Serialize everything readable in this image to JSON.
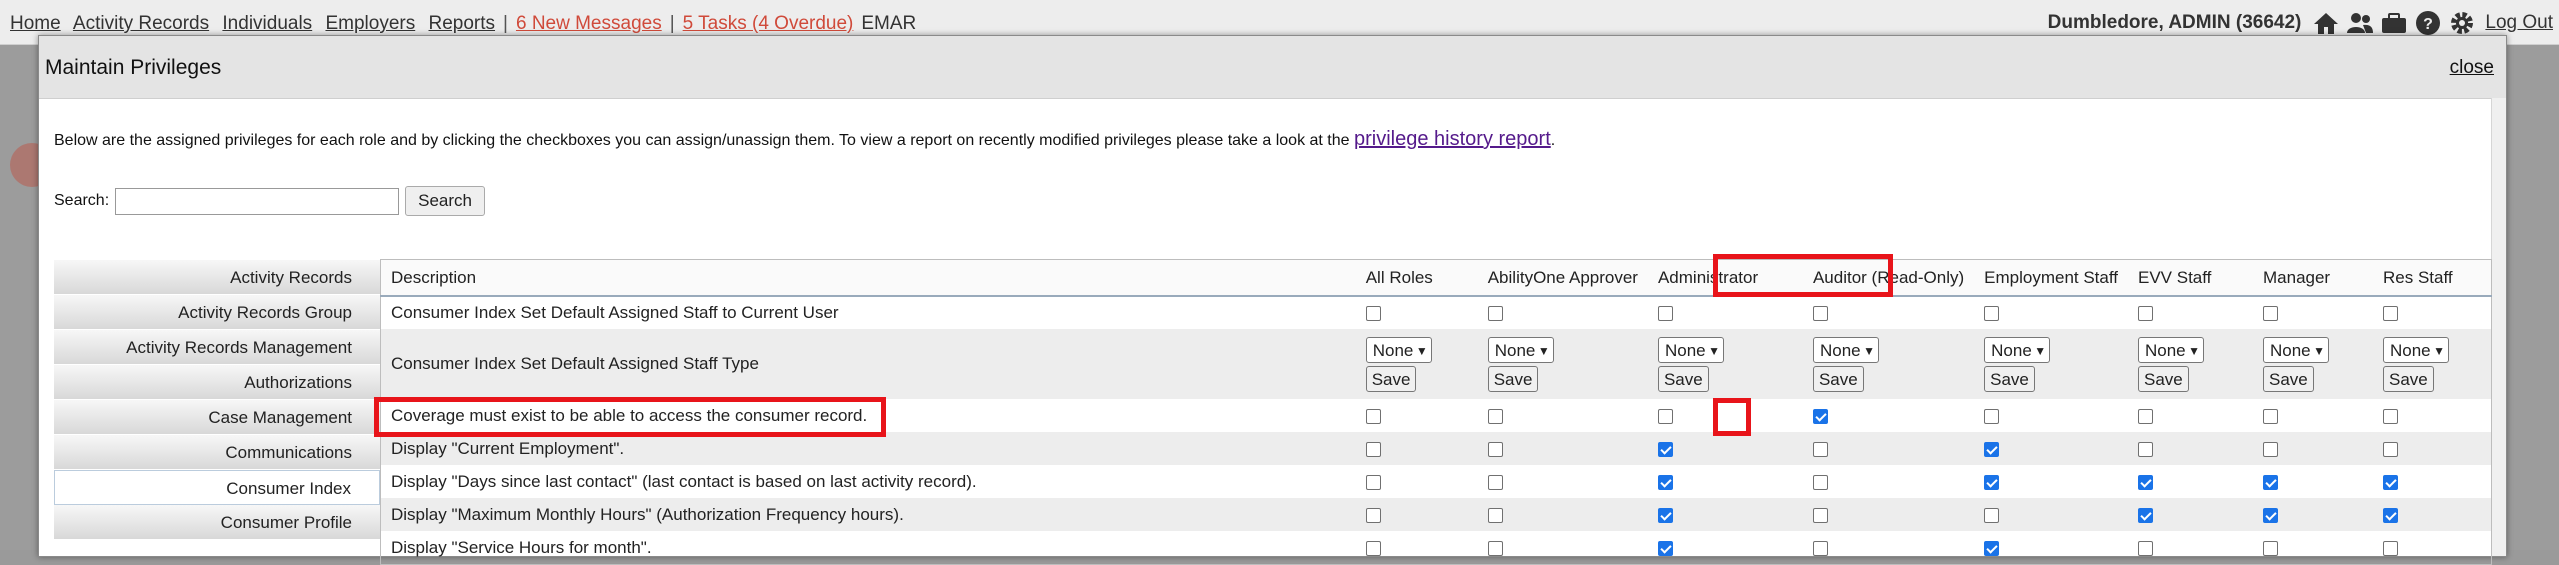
{
  "topbar": {
    "nav": [
      {
        "label": "Home"
      },
      {
        "label": "Activity Records"
      },
      {
        "label": "Individuals"
      },
      {
        "label": "Employers"
      },
      {
        "label": "Reports"
      }
    ],
    "messages": "6 New Messages",
    "tasks": "5 Tasks (4 Overdue)",
    "emar": "EMAR",
    "user": "Dumbledore, ADMIN (36642)",
    "logout": "Log Out",
    "icons": [
      "home-icon",
      "users-icon",
      "briefcase-icon",
      "help-icon",
      "gear-icon"
    ]
  },
  "dialog": {
    "title": "Maintain Privileges",
    "close": "close",
    "intro_text": "Below are the assigned privileges for each role and by clicking the checkboxes you can assign/unassign them.   To view a report on recently modified privileges please take a look at the ",
    "intro_link": "privilege history report",
    "intro_end": ".",
    "search_label": "Search:",
    "search_value": "",
    "search_button": "Search"
  },
  "roles": [
    "Activity Records",
    "Activity Records Group",
    "Activity Records Management",
    "Authorizations",
    "Case Management",
    "Communications",
    "Consumer Index",
    "Consumer Profile"
  ],
  "active_role": "Consumer Index",
  "columns": [
    "Description",
    "All Roles",
    "AbilityOne Approver",
    "Administrator",
    "Auditor (Read-Only)",
    "Employment Staff",
    "EVV Staff",
    "Manager",
    "Res Staff"
  ],
  "select_value": "None",
  "save_label": "Save",
  "rows": [
    {
      "desc": "Consumer Index Set Default Assigned Staff to Current User",
      "kind": "check",
      "values": [
        false,
        false,
        false,
        false,
        false,
        false,
        false,
        false
      ]
    },
    {
      "desc": "Consumer Index Set Default Assigned Staff Type",
      "kind": "select"
    },
    {
      "desc": "Coverage must exist to be able to access the consumer record.",
      "kind": "check",
      "values": [
        false,
        false,
        false,
        true,
        false,
        false,
        false,
        false
      ]
    },
    {
      "desc": "Display \"Current Employment\".",
      "kind": "check",
      "values": [
        false,
        false,
        true,
        false,
        true,
        false,
        false,
        false
      ]
    },
    {
      "desc": "Display \"Days since last contact\" (last contact is based on last activity record).",
      "kind": "check",
      "values": [
        false,
        false,
        true,
        false,
        true,
        true,
        true,
        true
      ]
    },
    {
      "desc": "Display \"Maximum Monthly Hours\" (Authorization Frequency hours).",
      "kind": "check",
      "values": [
        false,
        false,
        true,
        false,
        false,
        true,
        true,
        true
      ]
    },
    {
      "desc": "Display \"Service Hours for month\".",
      "kind": "check",
      "values": [
        false,
        false,
        true,
        false,
        true,
        false,
        false,
        false
      ]
    }
  ],
  "colors": {
    "highlight": "#e8141a",
    "checked": "#1a73e8",
    "alert": "#d04a3a"
  }
}
